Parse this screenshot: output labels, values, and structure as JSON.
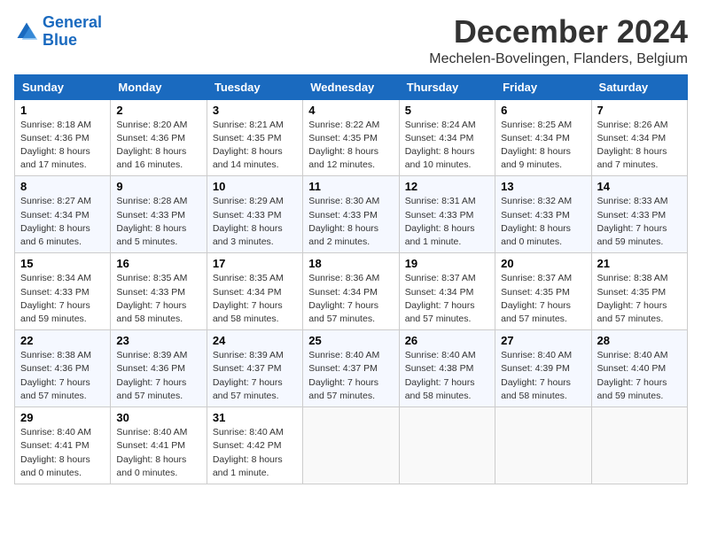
{
  "logo": {
    "line1": "General",
    "line2": "Blue"
  },
  "title": "December 2024",
  "subtitle": "Mechelen-Bovelingen, Flanders, Belgium",
  "days_of_week": [
    "Sunday",
    "Monday",
    "Tuesday",
    "Wednesday",
    "Thursday",
    "Friday",
    "Saturday"
  ],
  "weeks": [
    [
      {
        "day": 1,
        "info": "Sunrise: 8:18 AM\nSunset: 4:36 PM\nDaylight: 8 hours\nand 17 minutes."
      },
      {
        "day": 2,
        "info": "Sunrise: 8:20 AM\nSunset: 4:36 PM\nDaylight: 8 hours\nand 16 minutes."
      },
      {
        "day": 3,
        "info": "Sunrise: 8:21 AM\nSunset: 4:35 PM\nDaylight: 8 hours\nand 14 minutes."
      },
      {
        "day": 4,
        "info": "Sunrise: 8:22 AM\nSunset: 4:35 PM\nDaylight: 8 hours\nand 12 minutes."
      },
      {
        "day": 5,
        "info": "Sunrise: 8:24 AM\nSunset: 4:34 PM\nDaylight: 8 hours\nand 10 minutes."
      },
      {
        "day": 6,
        "info": "Sunrise: 8:25 AM\nSunset: 4:34 PM\nDaylight: 8 hours\nand 9 minutes."
      },
      {
        "day": 7,
        "info": "Sunrise: 8:26 AM\nSunset: 4:34 PM\nDaylight: 8 hours\nand 7 minutes."
      }
    ],
    [
      {
        "day": 8,
        "info": "Sunrise: 8:27 AM\nSunset: 4:34 PM\nDaylight: 8 hours\nand 6 minutes."
      },
      {
        "day": 9,
        "info": "Sunrise: 8:28 AM\nSunset: 4:33 PM\nDaylight: 8 hours\nand 5 minutes."
      },
      {
        "day": 10,
        "info": "Sunrise: 8:29 AM\nSunset: 4:33 PM\nDaylight: 8 hours\nand 3 minutes."
      },
      {
        "day": 11,
        "info": "Sunrise: 8:30 AM\nSunset: 4:33 PM\nDaylight: 8 hours\nand 2 minutes."
      },
      {
        "day": 12,
        "info": "Sunrise: 8:31 AM\nSunset: 4:33 PM\nDaylight: 8 hours\nand 1 minute."
      },
      {
        "day": 13,
        "info": "Sunrise: 8:32 AM\nSunset: 4:33 PM\nDaylight: 8 hours\nand 0 minutes."
      },
      {
        "day": 14,
        "info": "Sunrise: 8:33 AM\nSunset: 4:33 PM\nDaylight: 7 hours\nand 59 minutes."
      }
    ],
    [
      {
        "day": 15,
        "info": "Sunrise: 8:34 AM\nSunset: 4:33 PM\nDaylight: 7 hours\nand 59 minutes."
      },
      {
        "day": 16,
        "info": "Sunrise: 8:35 AM\nSunset: 4:33 PM\nDaylight: 7 hours\nand 58 minutes."
      },
      {
        "day": 17,
        "info": "Sunrise: 8:35 AM\nSunset: 4:34 PM\nDaylight: 7 hours\nand 58 minutes."
      },
      {
        "day": 18,
        "info": "Sunrise: 8:36 AM\nSunset: 4:34 PM\nDaylight: 7 hours\nand 57 minutes."
      },
      {
        "day": 19,
        "info": "Sunrise: 8:37 AM\nSunset: 4:34 PM\nDaylight: 7 hours\nand 57 minutes."
      },
      {
        "day": 20,
        "info": "Sunrise: 8:37 AM\nSunset: 4:35 PM\nDaylight: 7 hours\nand 57 minutes."
      },
      {
        "day": 21,
        "info": "Sunrise: 8:38 AM\nSunset: 4:35 PM\nDaylight: 7 hours\nand 57 minutes."
      }
    ],
    [
      {
        "day": 22,
        "info": "Sunrise: 8:38 AM\nSunset: 4:36 PM\nDaylight: 7 hours\nand 57 minutes."
      },
      {
        "day": 23,
        "info": "Sunrise: 8:39 AM\nSunset: 4:36 PM\nDaylight: 7 hours\nand 57 minutes."
      },
      {
        "day": 24,
        "info": "Sunrise: 8:39 AM\nSunset: 4:37 PM\nDaylight: 7 hours\nand 57 minutes."
      },
      {
        "day": 25,
        "info": "Sunrise: 8:40 AM\nSunset: 4:37 PM\nDaylight: 7 hours\nand 57 minutes."
      },
      {
        "day": 26,
        "info": "Sunrise: 8:40 AM\nSunset: 4:38 PM\nDaylight: 7 hours\nand 58 minutes."
      },
      {
        "day": 27,
        "info": "Sunrise: 8:40 AM\nSunset: 4:39 PM\nDaylight: 7 hours\nand 58 minutes."
      },
      {
        "day": 28,
        "info": "Sunrise: 8:40 AM\nSunset: 4:40 PM\nDaylight: 7 hours\nand 59 minutes."
      }
    ],
    [
      {
        "day": 29,
        "info": "Sunrise: 8:40 AM\nSunset: 4:41 PM\nDaylight: 8 hours\nand 0 minutes."
      },
      {
        "day": 30,
        "info": "Sunrise: 8:40 AM\nSunset: 4:41 PM\nDaylight: 8 hours\nand 0 minutes."
      },
      {
        "day": 31,
        "info": "Sunrise: 8:40 AM\nSunset: 4:42 PM\nDaylight: 8 hours\nand 1 minute."
      },
      null,
      null,
      null,
      null
    ]
  ]
}
